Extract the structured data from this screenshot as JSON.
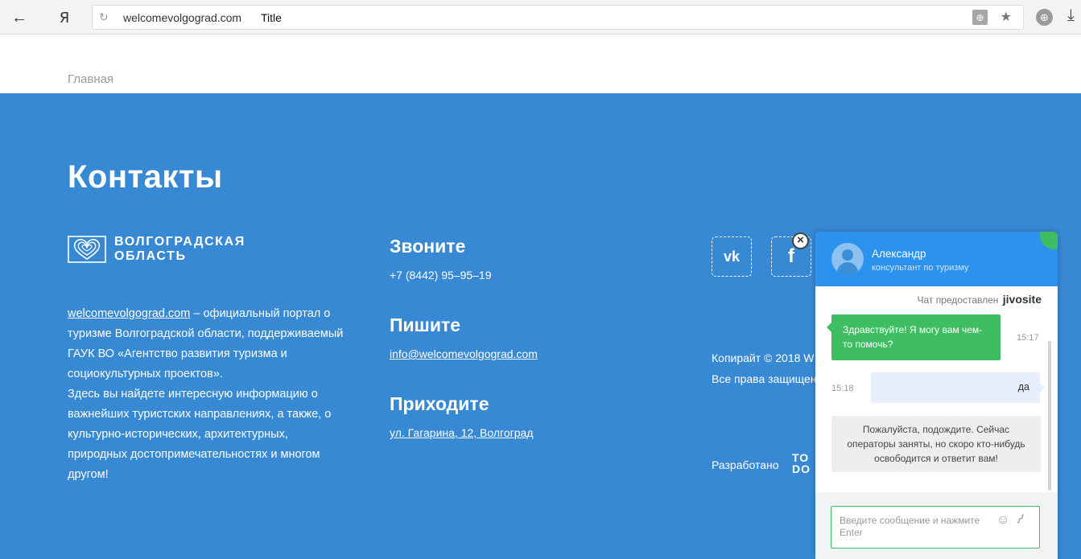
{
  "browser": {
    "back_icon": "arrow-left-icon",
    "back_glyph": "←",
    "yandex_glyph": "Я",
    "reload_glyph": "↻",
    "url_domain": "welcomevolgograd.com",
    "tab_title": "Title",
    "protect_glyph": "⊕",
    "bookmark_glyph": "★",
    "globe_glyph": "⊕",
    "download_glyph": "⤓"
  },
  "page": {
    "breadcrumb": "Главная",
    "contacts_title": "Контакты",
    "logo_line1": "ВОЛГОГРАДСКАЯ",
    "logo_line2": "ОБЛАСТЬ",
    "about_link": "welcomevolgograd.com",
    "about_text1": " – официальный портал о туризме Волгоградской области, поддерживаемый ГАУК ВО «Агентство развития туризма и социокультурных проектов».",
    "about_text2": "Здесь вы найдете интересную информацию о важнейших туристских направлениях, а также, о культурно-исторических, архитектурных, природных достопримечательностях и многом другом!",
    "call_title": "Звоните",
    "call_value": "+7 (8442) 95–95–19",
    "write_title": "Пишите",
    "write_value": "info@welcomevolgograd.com",
    "come_title": "Приходите",
    "come_value": "ул. Гагарина, 12, Волгоград",
    "vk_label": "vk",
    "fb_label": "f",
    "copyright_line1": "Копирайт © 2018 W",
    "copyright_line2": "Все права защищены",
    "developed_by": "Разработано",
    "dev_logo_line1": "TO",
    "dev_logo_line2": "DO"
  },
  "chat": {
    "operator_name": "Александр",
    "operator_role": "консультант по туризму",
    "powered_by": "Чат предоставлен",
    "powered_brand": "jivosite",
    "msg_operator": "Здравствуйте! Я могу вам чем-то помочь?",
    "time_operator": "15:17",
    "msg_user": "да",
    "time_user": "15:18",
    "msg_system": "Пожалуйста, подождите. Сейчас операторы заняты, но скоро кто-нибудь освободится и ответит вам!",
    "input_placeholder": "Введите сообщение и нажмите Enter",
    "smile_glyph": "☺",
    "clip_glyph": "⌇",
    "close_glyph": "×",
    "accent_color": "#2b92ee",
    "operator_bubble_color": "#3ebd62"
  },
  "colors": {
    "footer_bg": "#3889d4"
  }
}
